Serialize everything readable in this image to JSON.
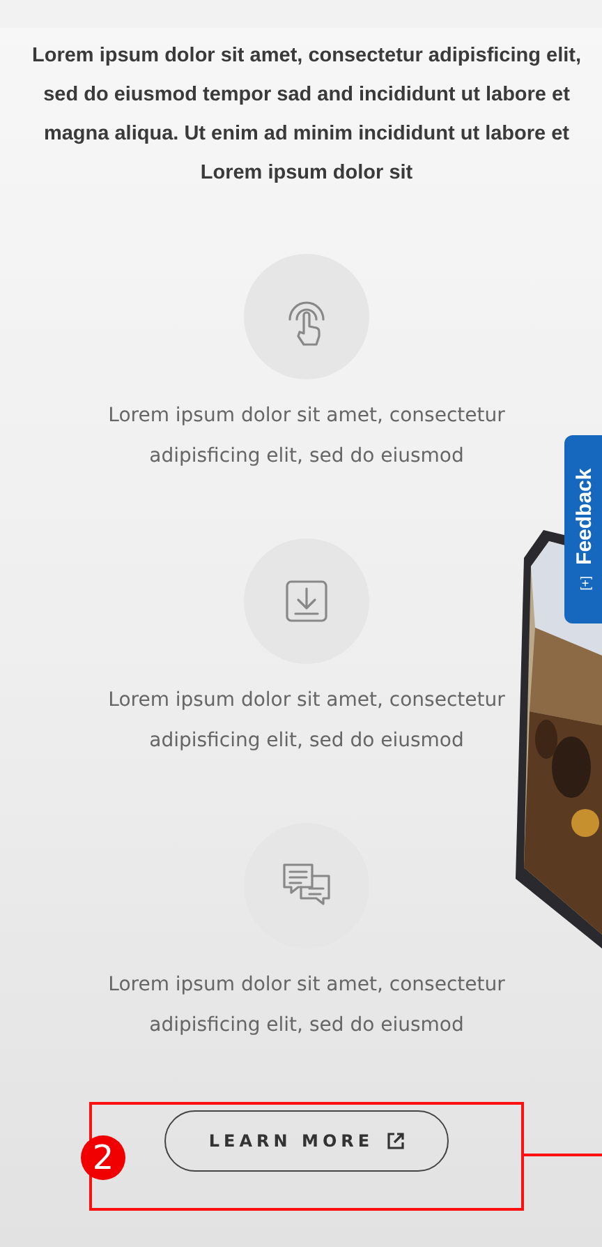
{
  "intro": "Lorem ipsum dolor sit amet, consectetur adipisficing elit, sed do eiusmod tempor sad and incididunt ut labore et magna aliqua. Ut enim ad minim incididunt ut labore et Lorem ipsum dolor sit",
  "features": [
    {
      "kind": "touch",
      "text": "Lorem ipsum dolor sit amet, consectetur adipisficing elit, sed do eiusmod"
    },
    {
      "kind": "download",
      "text": "Lorem ipsum dolor sit amet, consectetur adipisficing elit, sed do eiusmod"
    },
    {
      "kind": "chat",
      "text": "Lorem ipsum dolor sit amet, consectetur adipisficing elit, sed do eiusmod"
    }
  ],
  "button": {
    "label": "LEARN MORE"
  },
  "annotation": {
    "number": "2"
  },
  "feedback_tab": {
    "label": "Feedback",
    "toggle": "[+]"
  }
}
